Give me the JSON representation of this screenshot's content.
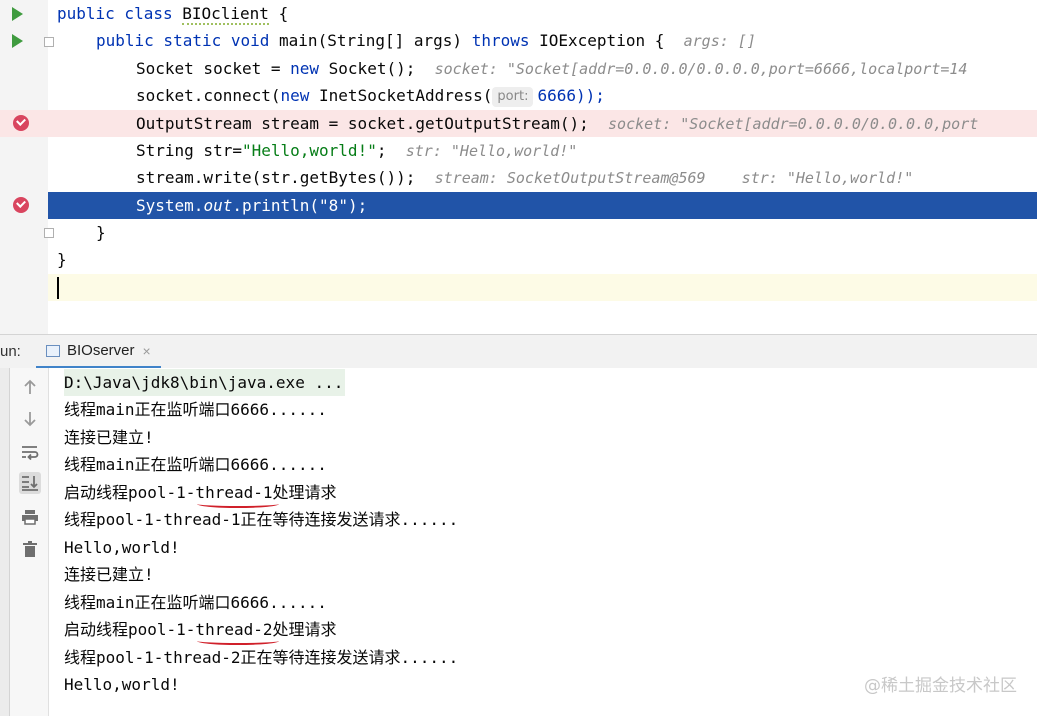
{
  "editor": {
    "lines": [
      {
        "segments": [
          [
            "kw",
            "public class "
          ],
          [
            "cls squiggle",
            "BIOclient"
          ],
          [
            "",
            "{"
          ]
        ]
      },
      {
        "segments": [
          [
            "kw",
            "public static void "
          ],
          [
            "",
            "main(String[] args) "
          ],
          [
            "kw",
            "throws "
          ],
          [
            "",
            "IOException {"
          ]
        ],
        "hint": "args: []"
      },
      {
        "segments": [
          [
            "",
            "Socket socket = "
          ],
          [
            "kw",
            "new "
          ],
          [
            "",
            "Socket();"
          ]
        ],
        "hint": "socket: \"Socket[addr=0.0.0.0/0.0.0.0,port=6666,localport=14"
      },
      {
        "segments": [
          [
            "",
            "socket.connect("
          ],
          [
            "kw",
            "new "
          ],
          [
            "",
            "InetSocketAddress("
          ]
        ],
        "param_hint": "port:",
        "tail": "6666));"
      },
      {
        "segments": [
          [
            "",
            "OutputStream stream = socket.getOutputStream();"
          ]
        ],
        "hint": "socket: \"Socket[addr=0.0.0.0/0.0.0.0,port"
      },
      {
        "segments": [
          [
            "",
            "String str="
          ],
          [
            "str",
            "\"Hello,world!\""
          ],
          [
            "",
            ";"
          ]
        ],
        "hint": "str: \"Hello,world!\""
      },
      {
        "segments": [
          [
            "",
            "stream.write(str.getBytes());"
          ]
        ],
        "hint": "stream: SocketOutputStream@569    str: \"Hello,world!\""
      },
      {
        "segments": [
          [
            "",
            "System."
          ],
          [
            "fld",
            "out"
          ],
          [
            "",
            ".println("
          ],
          [
            "str",
            "\"8\""
          ],
          [
            "",
            ");"
          ]
        ]
      },
      {
        "segments": [
          [
            "",
            "}"
          ]
        ]
      },
      {
        "segments": [
          [
            "",
            "}"
          ]
        ]
      }
    ]
  },
  "run": {
    "label": "un:",
    "tab_title": "BIOserver",
    "tab_close": "×"
  },
  "console": {
    "lines": [
      "D:\\Java\\jdk8\\bin\\java.exe ...",
      "线程main正在监听端口6666......",
      "连接已建立!",
      "线程main正在监听端口6666......",
      "启动线程pool-1-thread-1处理请求",
      "线程pool-1-thread-1正在等待连接发送请求......",
      "Hello,world!",
      "连接已建立!",
      "线程main正在监听端口6666......",
      "启动线程pool-1-thread-2处理请求",
      "线程pool-1-thread-2正在等待连接发送请求......",
      "Hello,world!"
    ]
  },
  "toolbar": {
    "buttons": [
      "arrow-up-icon",
      "arrow-down-icon",
      "soft-wrap-icon",
      "scroll-to-end-icon",
      "print-icon",
      "trash-icon"
    ]
  },
  "watermark": "@稀土掘金技术社区"
}
